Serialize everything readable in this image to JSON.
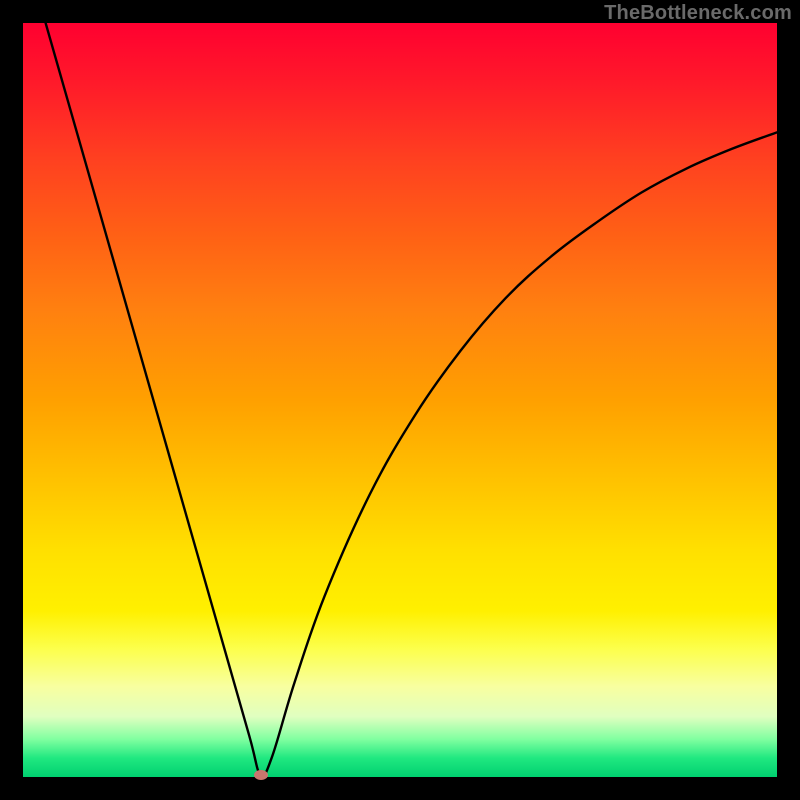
{
  "watermark": "TheBottleneck.com",
  "chart_data": {
    "type": "line",
    "title": "",
    "xlabel": "",
    "ylabel": "",
    "xlim": [
      0,
      100
    ],
    "ylim": [
      0,
      100
    ],
    "grid": false,
    "legend": false,
    "background_gradient": {
      "top": "#ff0030",
      "middle": "#ffe000",
      "bottom": "#00d070"
    },
    "series": [
      {
        "name": "curve",
        "color": "#000000",
        "x": [
          3,
          6,
          10,
          14,
          18,
          22,
          26,
          30,
          31.5,
          33,
          36,
          40,
          46,
          52,
          58,
          64,
          70,
          76,
          82,
          88,
          94,
          100
        ],
        "y": [
          100,
          89.5,
          75.5,
          61.5,
          47.5,
          33.5,
          19.5,
          5.5,
          0.3,
          2.6,
          12.5,
          24,
          37.5,
          48,
          56.5,
          63.5,
          69,
          73.5,
          77.5,
          80.7,
          83.3,
          85.5
        ]
      }
    ],
    "markers": [
      {
        "name": "min-dot",
        "x": 31.5,
        "y": 0.3,
        "color": "#c9766e"
      }
    ]
  }
}
